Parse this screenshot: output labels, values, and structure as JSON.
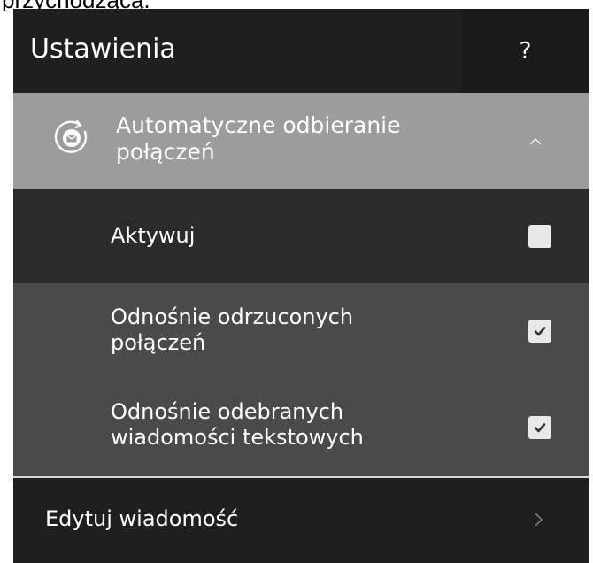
{
  "top_clip": {
    "text": "przychodzącą."
  },
  "header": {
    "title": "Ustawienia",
    "help_label": "?"
  },
  "section": {
    "title_line1": "Automatyczne odbieranie",
    "title_line2": "połączeń",
    "expanded": true
  },
  "options": {
    "activate": {
      "label": "Aktywuj",
      "checked": false
    },
    "rejected_calls": {
      "label_line1": "Odnośnie odrzuconych",
      "label_line2": "połączeń",
      "checked": true
    },
    "received_sms": {
      "label_line1": "Odnośnie odebranych",
      "label_line2": "wiadomości tekstowych",
      "checked": true
    }
  },
  "edit_message": {
    "label": "Edytuj wiadomość"
  },
  "colors": {
    "header_bg": "#1f1f1f",
    "section_header_bg": "#9c9c9c",
    "activate_row_bg": "#2b2b2b",
    "sub_row_bg": "#4a4a4a",
    "text": "#ffffff",
    "checkbox_bg": "#e8e8e8"
  }
}
